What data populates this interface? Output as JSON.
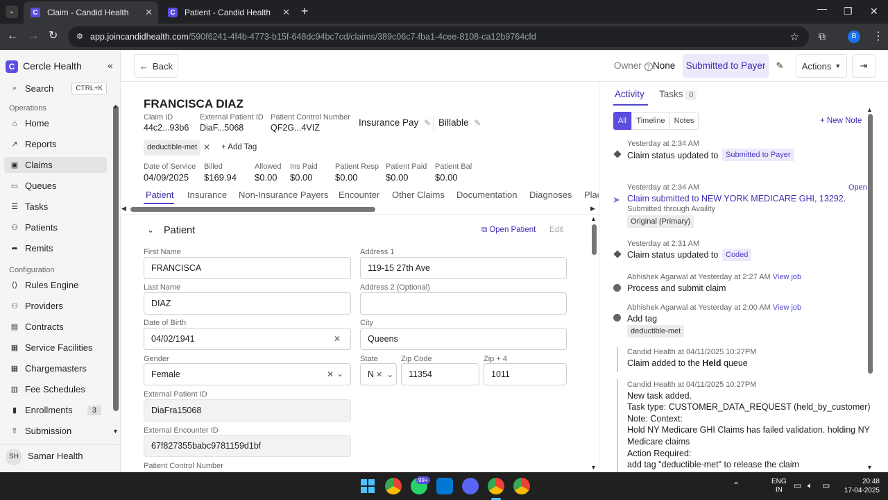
{
  "browser": {
    "tabs": [
      {
        "title": "Claim - Candid Health",
        "active": true
      },
      {
        "title": "Patient - Candid Health",
        "active": false
      }
    ],
    "url_host": "app.joincandidhealth.com",
    "url_path": "/590f6241-4f4b-4773-b15f-648dc94bc7cd/claims/389c06c7-fba1-4cee-8108-ca12b9764cfd",
    "profile_initial": "B"
  },
  "sidebar": {
    "org_name": "Cercle Health",
    "search_label": "Search",
    "search_shortcut": "CTRL+K",
    "section_operations": "Operations",
    "ops_items": [
      {
        "label": "Home",
        "icon": "home-icon",
        "glyph": "⌂"
      },
      {
        "label": "Reports",
        "icon": "chart-icon",
        "glyph": "↗"
      },
      {
        "label": "Claims",
        "icon": "folder-icon",
        "glyph": "▣",
        "selected": true
      },
      {
        "label": "Queues",
        "icon": "inbox-icon",
        "glyph": "▭"
      },
      {
        "label": "Tasks",
        "icon": "list-icon",
        "glyph": "☰"
      },
      {
        "label": "Patients",
        "icon": "users-icon",
        "glyph": "⚇"
      },
      {
        "label": "Remits",
        "icon": "share-icon",
        "glyph": "➦"
      }
    ],
    "section_configuration": "Configuration",
    "config_items": [
      {
        "label": "Rules Engine",
        "icon": "code-icon",
        "glyph": "⟨⟩"
      },
      {
        "label": "Providers",
        "icon": "user-icon",
        "glyph": "⚇"
      },
      {
        "label": "Contracts",
        "icon": "document-icon",
        "glyph": "▤"
      },
      {
        "label": "Service Facilities",
        "icon": "building-icon",
        "glyph": "▦"
      },
      {
        "label": "Chargemasters",
        "icon": "table-icon",
        "glyph": "▦"
      },
      {
        "label": "Fee Schedules",
        "icon": "calendar-icon",
        "glyph": "▥"
      },
      {
        "label": "Enrollments",
        "icon": "bookmark-icon",
        "glyph": "▮",
        "badge": "3"
      },
      {
        "label": "Submission",
        "icon": "upload-icon",
        "glyph": "⇧"
      }
    ],
    "user_initials": "SH",
    "user_name": "Samar Health"
  },
  "header": {
    "back_label": "Back",
    "owner_label": "Owner",
    "owner_value": "None",
    "status": "Submitted to Payer",
    "actions_label": "Actions"
  },
  "claim": {
    "patient_name": "FRANCISCA DIAZ",
    "meta": [
      {
        "label": "Claim ID",
        "value": "44c2...93b6"
      },
      {
        "label": "External Patient ID",
        "value": "DiaF...5068"
      },
      {
        "label": "Patient Control Number",
        "value": "QF2G...4VIZ"
      }
    ],
    "insurance_pay": "Insurance Pay",
    "billable": "Billable",
    "tag": "deductible-met",
    "add_tag": "Add Tag",
    "financials": [
      {
        "label": "Date of Service",
        "value": "04/09/2025"
      },
      {
        "label": "Billed",
        "value": "$169.94"
      },
      {
        "label": "Allowed",
        "value": "$0.00"
      },
      {
        "label": "Ins Paid",
        "value": "$0.00"
      },
      {
        "label": "Patient Resp",
        "value": "$0.00"
      },
      {
        "label": "Patient Paid",
        "value": "$0.00"
      },
      {
        "label": "Patient Bal",
        "value": "$0.00"
      }
    ],
    "tabs": [
      "Patient",
      "Insurance",
      "Non-Insurance Payers",
      "Encounter",
      "Other Claims",
      "Documentation",
      "Diagnoses",
      "Plac"
    ],
    "active_tab": "Patient"
  },
  "patient_section": {
    "title": "Patient",
    "open_patient": "Open Patient",
    "edit": "Edit",
    "first_name_label": "First Name",
    "first_name": "FRANCISCA",
    "last_name_label": "Last Name",
    "last_name": "DIAZ",
    "dob_label": "Date of Birth",
    "dob": "04/02/1941",
    "gender_label": "Gender",
    "gender": "Female",
    "ext_patient_id_label": "External Patient ID",
    "ext_patient_id": "DiaFra15068",
    "ext_encounter_id_label": "External Encounter ID",
    "ext_encounter_id": "67f827355babc9781159d1bf",
    "pcn_label": "Patient Control Number",
    "address1_label": "Address 1",
    "address1": "119-15 27th Ave",
    "address2_label": "Address 2 (Optional)",
    "address2": "",
    "city_label": "City",
    "city": "Queens",
    "state_label": "State",
    "state": "N",
    "zip_label": "Zip Code",
    "zip": "11354",
    "zip4_label": "Zip + 4",
    "zip4": "1011"
  },
  "activity": {
    "tab_activity": "Activity",
    "tab_tasks": "Tasks",
    "tasks_count": "0",
    "filters": [
      "All",
      "Timeline",
      "Notes"
    ],
    "new_note": "New Note",
    "items": [
      {
        "time": "Yesterday at 2:34 AM",
        "title": "Claim status updated to",
        "chip": "Submitted to Payer"
      },
      {
        "time": "Yesterday at 2:34 AM",
        "action": "Open",
        "title": "Claim submitted to NEW YORK MEDICARE GHI, 13292.",
        "sub": "Submitted through Availity",
        "chip": "Original (Primary)"
      },
      {
        "time": "Yesterday at 2:31 AM",
        "title": "Claim status updated to",
        "chip": "Coded"
      },
      {
        "time": "Abhishek Agarwal at Yesterday at 2:27 AM",
        "link": "View job",
        "title": "Process and submit claim"
      },
      {
        "time": "Abhishek Agarwal at Yesterday at 2:00 AM",
        "link": "View job",
        "title": "Add tag",
        "chip": "deductible-met"
      },
      {
        "time": "Candid Health at 04/11/2025 10:27PM",
        "title_pre": "Claim added to the",
        "title_bold": "Held",
        "title_post": "queue"
      },
      {
        "time": "Candid Health at 04/11/2025 10:27PM",
        "lines": [
          "New task added.",
          "Task type: CUSTOMER_DATA_REQUEST (held_by_customer)",
          "Note: Context:",
          "Hold NY Medicare GHI Claims has failed validation. holding NY",
          "Medicare claims",
          "Action Required:",
          "add tag \"deductible-met\" to release the claim"
        ]
      }
    ]
  },
  "taskbar": {
    "lang": "ENG",
    "region": "IN",
    "time": "20:48",
    "date": "17-04-2025",
    "notif_badge": "99+"
  }
}
